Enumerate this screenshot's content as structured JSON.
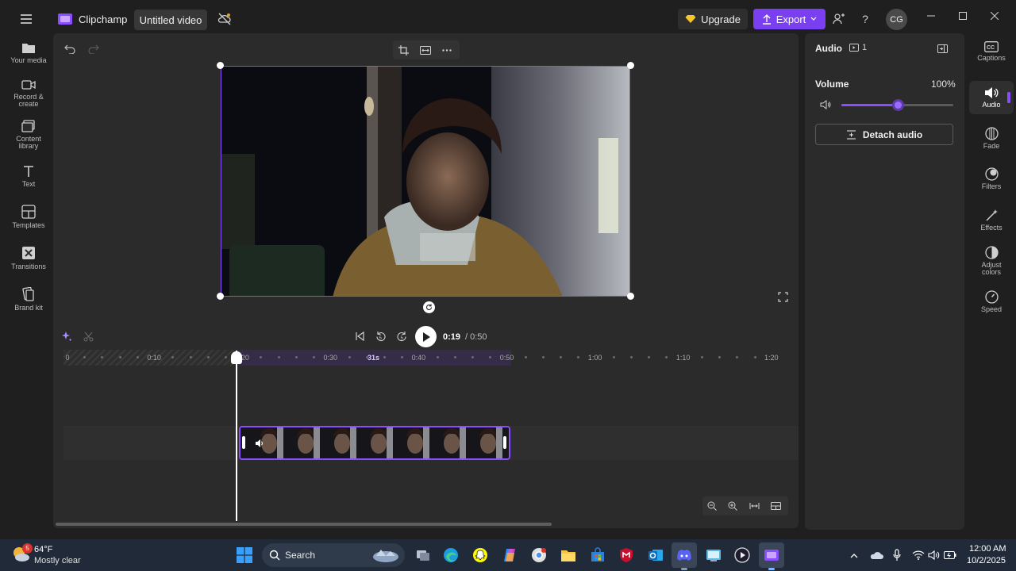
{
  "app": {
    "name": "Clipchamp",
    "project_title": "Untitled video"
  },
  "header": {
    "upgrade_label": "Upgrade",
    "export_label": "Export",
    "avatar_initials": "CG"
  },
  "left_nav": [
    {
      "label": "Your media",
      "icon": "folder-icon"
    },
    {
      "label": "Record & create",
      "icon": "camera-icon"
    },
    {
      "label": "Content library",
      "icon": "library-icon"
    },
    {
      "label": "Text",
      "icon": "text-icon"
    },
    {
      "label": "Templates",
      "icon": "templates-icon"
    },
    {
      "label": "Transitions",
      "icon": "transitions-icon"
    },
    {
      "label": "Brand kit",
      "icon": "brand-kit-icon"
    }
  ],
  "player": {
    "current_time": "0:19",
    "total_time": "/ 0:50"
  },
  "timeline": {
    "ticks": [
      "0",
      "0:10",
      "0:20",
      "0:30",
      "0:40",
      "0:50",
      "1:00",
      "1:10",
      "1:20"
    ],
    "hover_time": "31s"
  },
  "panel": {
    "title": "Audio",
    "clip_count": "1",
    "volume_label": "Volume",
    "volume_value": "100%",
    "volume_level": 0.5,
    "detach_label": "Detach audio"
  },
  "right_nav": [
    {
      "label": "Captions",
      "icon": "captions-icon"
    },
    {
      "label": "Audio",
      "icon": "speaker-icon"
    },
    {
      "label": "Fade",
      "icon": "fade-icon"
    },
    {
      "label": "Filters",
      "icon": "filters-icon"
    },
    {
      "label": "Effects",
      "icon": "effects-icon"
    },
    {
      "label": "Adjust colors",
      "icon": "adjust-colors-icon"
    },
    {
      "label": "Speed",
      "icon": "speed-icon"
    }
  ],
  "taskbar": {
    "weather_temp": "64°F",
    "weather_desc": "Mostly clear",
    "weather_badge": "5",
    "search_label": "Search",
    "time": "12:00 AM",
    "date": "10/2/2025"
  },
  "colors": {
    "accent": "#7a3ff0",
    "bg": "#1f1f1f",
    "surface": "#2b2b2b",
    "taskbar": "#202a38"
  }
}
